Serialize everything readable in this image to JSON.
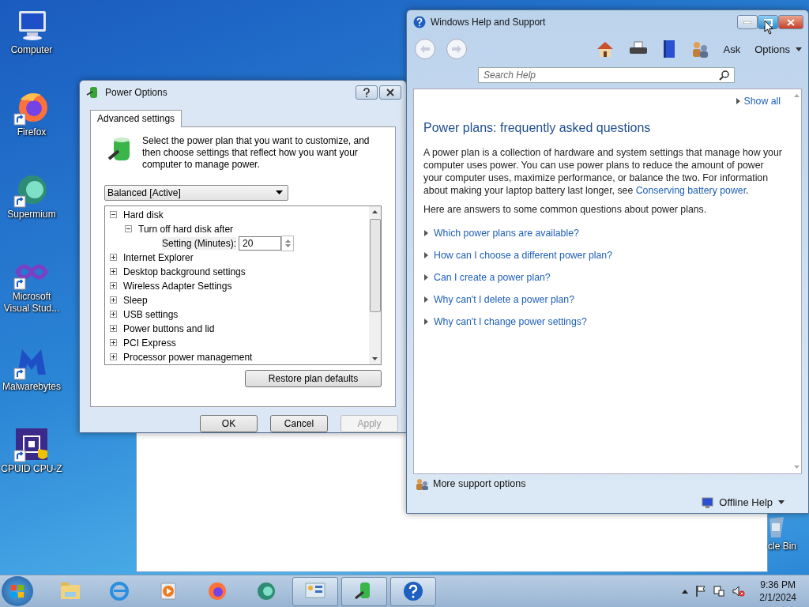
{
  "desktop_icons": [
    {
      "kind": "computer",
      "label": "Computer",
      "shortcut": false
    },
    {
      "kind": "firefox",
      "label": "Firefox",
      "shortcut": true
    },
    {
      "kind": "supermium",
      "label": "Supermium",
      "shortcut": true
    },
    {
      "kind": "vs",
      "label": "Microsoft Visual Stud...",
      "shortcut": true
    },
    {
      "kind": "malwarebytes",
      "label": "Malwarebytes",
      "shortcut": true
    },
    {
      "kind": "cpuz",
      "label": "CPUID CPU-Z",
      "shortcut": true
    }
  ],
  "recycle_bin": {
    "label": "cle Bin"
  },
  "power_options": {
    "title": "Power Options",
    "tabs": [
      {
        "label": "Advanced settings",
        "selected": true
      }
    ],
    "description": "Select the power plan that you want to customize, and then choose settings that reflect how you want your computer to manage power.",
    "plan": "Balanced [Active]",
    "tree": [
      {
        "kind": "group",
        "label": "Hard disk",
        "expanded": true,
        "children": [
          {
            "kind": "group",
            "label": "Turn off hard disk after",
            "expanded": true,
            "children": [
              {
                "kind": "setting",
                "label": "Setting (Minutes):",
                "value": "20"
              }
            ]
          }
        ]
      },
      {
        "kind": "group",
        "label": "Internet Explorer",
        "expanded": false
      },
      {
        "kind": "group",
        "label": "Desktop background settings",
        "expanded": false
      },
      {
        "kind": "group",
        "label": "Wireless Adapter Settings",
        "expanded": false
      },
      {
        "kind": "group",
        "label": "Sleep",
        "expanded": false
      },
      {
        "kind": "group",
        "label": "USB settings",
        "expanded": false
      },
      {
        "kind": "group",
        "label": "Power buttons and lid",
        "expanded": false
      },
      {
        "kind": "group",
        "label": "PCI Express",
        "expanded": false
      },
      {
        "kind": "group",
        "label": "Processor power management",
        "expanded": false
      }
    ],
    "restore_button": "Restore plan defaults",
    "buttons": [
      {
        "label": "OK",
        "disabled": false
      },
      {
        "label": "Cancel",
        "disabled": false
      },
      {
        "label": "Apply",
        "disabled": true
      }
    ]
  },
  "help": {
    "title": "Windows Help and Support",
    "toolbar": {
      "ask": "Ask",
      "options": "Options"
    },
    "search": {
      "placeholder": "Search Help"
    },
    "show_all": "Show all",
    "heading": "Power plans: frequently asked questions",
    "paragraph": {
      "before": "A power plan is a collection of hardware and system settings that manage how your computer uses power. You can use power plans to reduce the amount of power your computer uses, maximize performance, or balance the two. For information about making your laptop battery last longer, see ",
      "link": "Conserving battery power",
      "after": "."
    },
    "intro": "Here are answers to some common questions about power plans.",
    "questions": [
      "Which power plans are available?",
      "How can I choose a different power plan?",
      "Can I create a power plan?",
      "Why can't I delete a power plan?",
      "Why can't I change power settings?"
    ],
    "more_support": "More support options",
    "offline_help": "Offline Help"
  },
  "taskbar": {
    "items": [
      {
        "kind": "explorer",
        "open": false
      },
      {
        "kind": "ie",
        "open": false
      },
      {
        "kind": "media",
        "open": false
      },
      {
        "kind": "firefox",
        "open": false
      },
      {
        "kind": "supermium",
        "open": false
      },
      {
        "kind": "control-panel",
        "open": true
      },
      {
        "kind": "power",
        "open": true
      },
      {
        "kind": "help",
        "open": true
      }
    ],
    "time": "9:36 PM",
    "date": "2/1/2024"
  }
}
